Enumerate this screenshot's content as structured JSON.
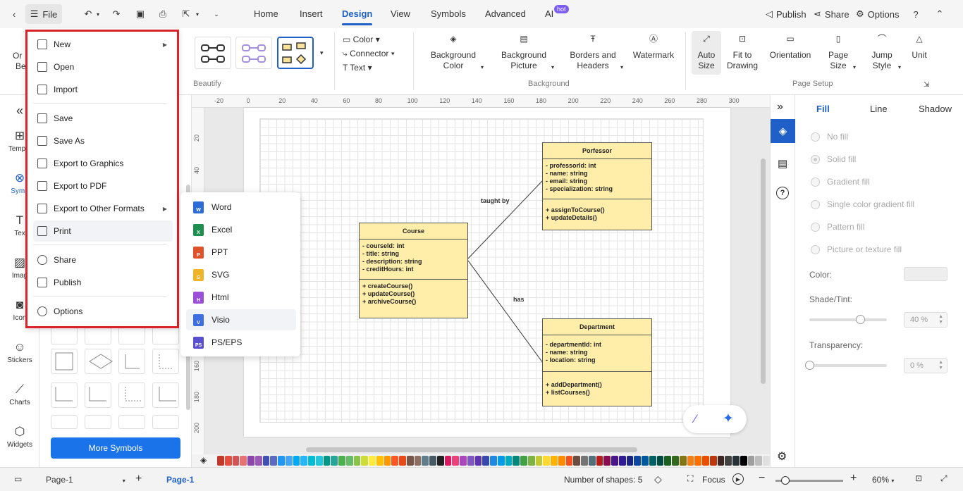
{
  "topbar": {
    "file_label": "File",
    "tabs": [
      {
        "label": "Home"
      },
      {
        "label": "Insert"
      },
      {
        "label": "Design"
      },
      {
        "label": "View"
      },
      {
        "label": "Symbols"
      },
      {
        "label": "Advanced"
      },
      {
        "label": "AI"
      }
    ],
    "hot_badge": "hot",
    "publish": "Publish",
    "share": "Share",
    "options": "Options"
  },
  "ribbon": {
    "left_cut_1": "Or",
    "left_cut_2": "Be",
    "beautify": "Beautify",
    "color": "Color",
    "connector": "Connector",
    "text": "Text",
    "background_color_1": "Background",
    "background_color_2": "Color",
    "background_picture_1": "Background",
    "background_picture_2": "Picture",
    "borders_1": "Borders and",
    "borders_2": "Headers",
    "watermark": "Watermark",
    "background_section": "Background",
    "auto_size_1": "Auto",
    "auto_size_2": "Size",
    "fit_1": "Fit to",
    "fit_2": "Drawing",
    "orientation": "Orientation",
    "page_size_1": "Page",
    "page_size_2": "Size",
    "jump_1": "Jump",
    "jump_2": "Style",
    "unit": "Unit",
    "page_setup_section": "Page Setup"
  },
  "leftbar": {
    "templates": "Templa",
    "symbols": "Symb",
    "text": "Tex",
    "images": "Imag",
    "icons": "Icon",
    "stickers": "Stickers",
    "charts": "Charts",
    "widgets": "Widgets"
  },
  "symlib": {
    "more_symbols": "More Symbols"
  },
  "ruler": {
    "top": [
      "-20",
      "0",
      "20",
      "40",
      "60",
      "80",
      "100",
      "120",
      "140",
      "160",
      "180",
      "200",
      "220",
      "240",
      "260",
      "280",
      "300"
    ],
    "left": [
      "20",
      "40",
      "160",
      "180",
      "200"
    ]
  },
  "diagram": {
    "course": {
      "title": "Course",
      "attrs": [
        "- courseId: int",
        "- title: string",
        "- description: string",
        "- creditHours: int"
      ],
      "methods": [
        "+ createCourse()",
        "+ updateCourse()",
        "+ archiveCourse()"
      ]
    },
    "professor": {
      "title": "Porfessor",
      "attrs": [
        "- professorId: int",
        "- name: string",
        "- email: string",
        "- specialization: string"
      ],
      "methods": [
        "+ assignToCourse()",
        "+ updateDetails()"
      ]
    },
    "department": {
      "title": "Department",
      "attrs": [
        "- departmentId: int",
        "- name: string",
        "- location: string"
      ],
      "methods": [
        "+ addDepartment()",
        "+ listCourses()"
      ]
    },
    "label_taught_by": "taught by",
    "label_has": "has"
  },
  "file_menu": {
    "new": "New",
    "open": "Open",
    "import": "Import",
    "save": "Save",
    "save_as": "Save As",
    "export_graphics": "Export to Graphics",
    "export_pdf": "Export to PDF",
    "export_other": "Export to Other Formats",
    "print": "Print",
    "share": "Share",
    "publish": "Publish",
    "options": "Options"
  },
  "export_submenu": {
    "word": "Word",
    "excel": "Excel",
    "ppt": "PPT",
    "svg": "SVG",
    "html": "Html",
    "visio": "Visio",
    "pseps": "PS/EPS"
  },
  "props": {
    "tab_fill": "Fill",
    "tab_line": "Line",
    "tab_shadow": "Shadow",
    "no_fill": "No fill",
    "solid_fill": "Solid fill",
    "gradient_fill": "Gradient fill",
    "single_gradient": "Single color gradient fill",
    "pattern_fill": "Pattern fill",
    "picture_fill": "Picture or texture fill",
    "color": "Color:",
    "shade_tint": "Shade/Tint:",
    "shade_value": "40 %",
    "shade_level": 0.4,
    "transparency": "Transparency:",
    "transparency_value": "0 %",
    "transparency_level": 0
  },
  "statusbar": {
    "page_select": "Page-1",
    "page_tab": "Page-1",
    "shapes": "Number of shapes: 5",
    "focus": "Focus",
    "zoom": "60%"
  },
  "colors": {
    "accent": "#1f5fc7",
    "menu_outline": "#d9232d",
    "uml_fill": "#ffeeaa",
    "swatches": [
      "#c0392b",
      "#e74c3c",
      "#d35454",
      "#e57373",
      "#8e44ad",
      "#9b59b6",
      "#3f51b5",
      "#5c6bc0",
      "#2196f3",
      "#42a5f5",
      "#03a9f4",
      "#29b6f6",
      "#00bcd4",
      "#26c6da",
      "#009688",
      "#26a69a",
      "#4caf50",
      "#66bb6a",
      "#8bc34a",
      "#cddc39",
      "#ffeb3b",
      "#ffc107",
      "#ff9800",
      "#ff5722",
      "#e64a19",
      "#795548",
      "#8d6e63",
      "#607d8b",
      "#455a64",
      "#212121",
      "#d81b60",
      "#ec407a",
      "#ab47bc",
      "#7e57c2",
      "#5e35b1",
      "#3949ab",
      "#1e88e5",
      "#039be5",
      "#00acc1",
      "#00897b",
      "#43a047",
      "#7cb342",
      "#c0ca33",
      "#fdd835",
      "#ffb300",
      "#fb8c00",
      "#f4511e",
      "#6d4c41",
      "#757575",
      "#546e7a",
      "#b71c1c",
      "#880e4f",
      "#4a148c",
      "#311b92",
      "#1a237e",
      "#0d47a1",
      "#01579b",
      "#006064",
      "#004d40",
      "#1b5e20",
      "#33691e",
      "#827717",
      "#f57f17",
      "#ff6f00",
      "#e65100",
      "#bf360c",
      "#3e2723",
      "#424242",
      "#263238",
      "#000000",
      "#9e9e9e",
      "#bdbdbd",
      "#e0e0e0"
    ]
  }
}
